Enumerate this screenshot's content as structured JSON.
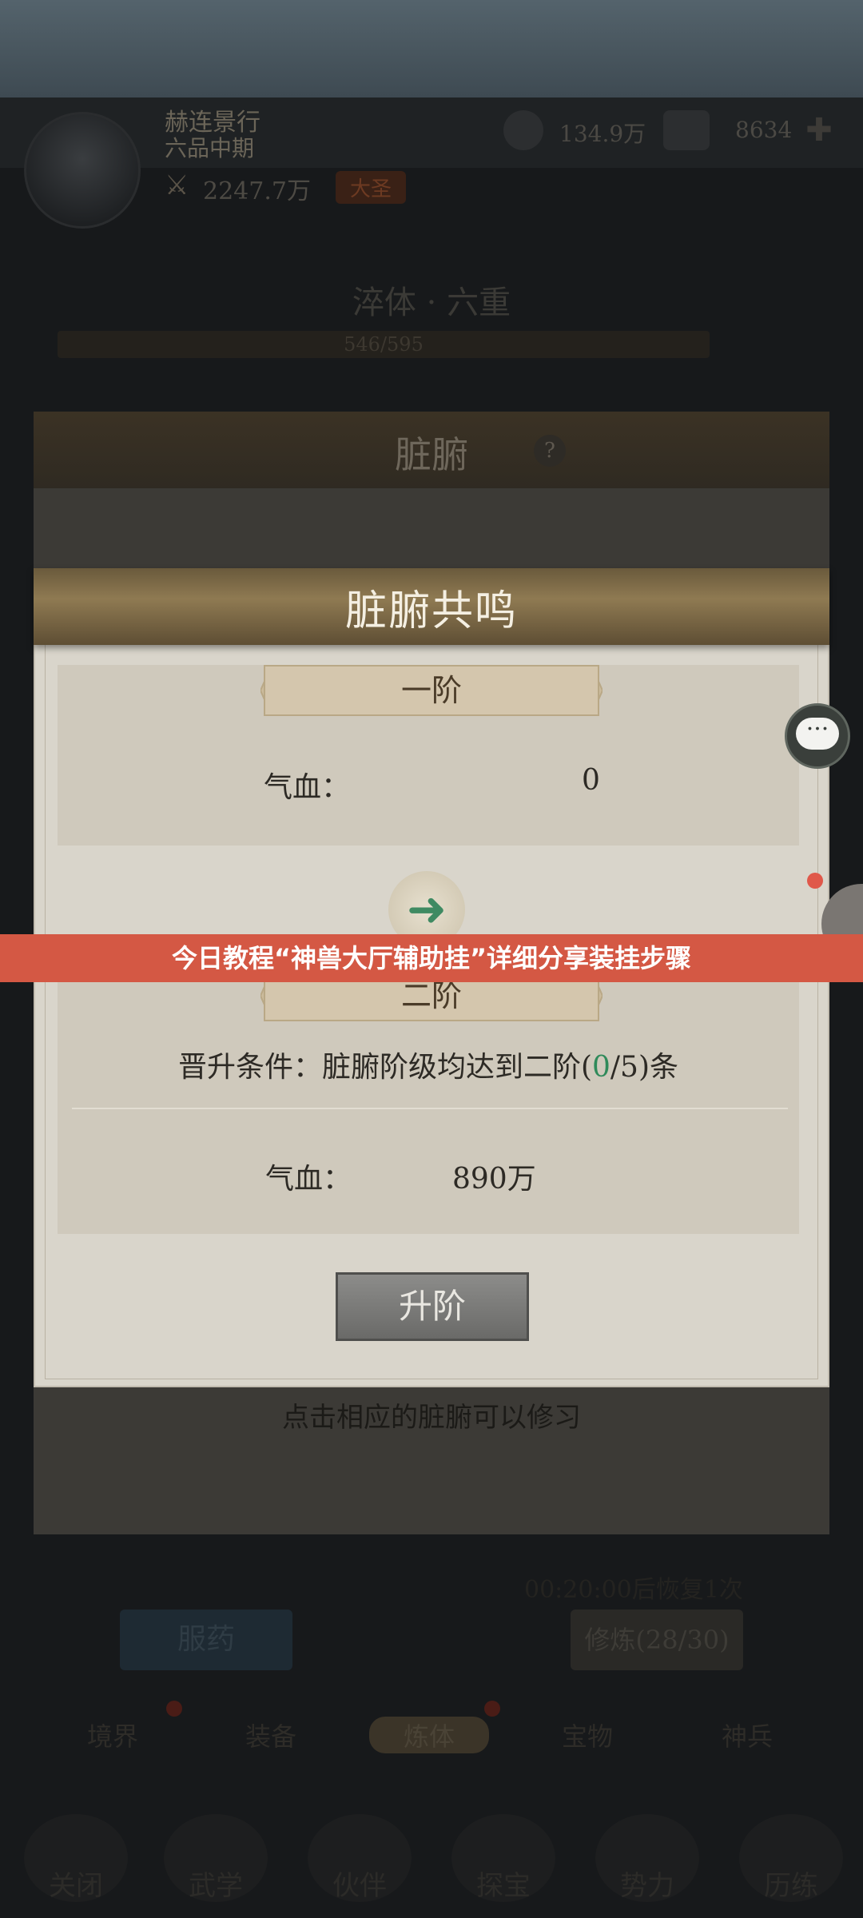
{
  "player": {
    "name": "赫连景行",
    "rank": "六品中期",
    "power": "2247.7万",
    "badge": "大圣",
    "res1": "134.9万",
    "res2": "8634"
  },
  "realm": {
    "title": "淬体 · 六重",
    "exp": "546/595"
  },
  "organ_panel": {
    "title": "脏腑",
    "help": "?",
    "hint": "点击相应的脏腑可以修习"
  },
  "modal": {
    "title": "脏腑共鸣",
    "tier1": {
      "label": "一阶",
      "stat_label": "气血：",
      "stat_value": "0"
    },
    "tier2": {
      "label": "二阶",
      "req_prefix": "晋升条件：脏腑阶级均达到二阶(",
      "req_current": "0",
      "req_suffix": "/5)条",
      "stat_label": "气血：",
      "stat_value": "890万"
    },
    "upgrade_button": "升阶"
  },
  "lower": {
    "recover_text": "00:20:00后恢复1次",
    "medicine_button": "服药",
    "train_button": "修炼(28/30)"
  },
  "subtabs": [
    "境界",
    "装备",
    "炼体",
    "宝物",
    "神兵"
  ],
  "bottom_nav": [
    "关闭",
    "武学",
    "伙伴",
    "探宝",
    "势力",
    "历练"
  ],
  "overlay_banner": "今日教程“神兽大厅辅助挂”详细分享装挂步骤",
  "colors": {
    "accent_green": "#2f8a5a",
    "banner_red": "#d45844"
  }
}
